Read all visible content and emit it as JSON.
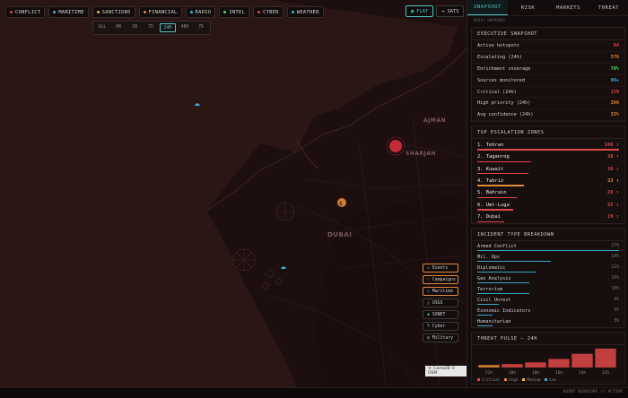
{
  "topbar": {
    "chips": [
      {
        "label": "CONFLICT",
        "color": "#e04040"
      },
      {
        "label": "MARITIME",
        "color": "#3ab0d8"
      },
      {
        "label": "SANCTIONS",
        "color": "#e0c040"
      },
      {
        "label": "FINANCIAL",
        "color": "#e08a3a"
      },
      {
        "label": "RADIO",
        "color": "#3ab0d8"
      },
      {
        "label": "INTEL",
        "color": "#60d060"
      },
      {
        "label": "CYBER",
        "color": "#e04040"
      },
      {
        "label": "WEATHER",
        "color": "#3ab0d8"
      }
    ]
  },
  "timebar": {
    "options": [
      "ALL",
      "6M",
      "1M",
      "7D",
      "24H",
      "48H",
      "7D"
    ],
    "active_index": 4
  },
  "view": {
    "flat": "FLAT",
    "sats": "SATS"
  },
  "map": {
    "labels": {
      "ajman": "AJMAN",
      "sharjah": "SHARJAH",
      "dubai": "DUBAI"
    },
    "attribution": "© CartoDB © OSM"
  },
  "layers": [
    {
      "label": "Events",
      "on": true,
      "icon": "◇",
      "color": "#e08a3a"
    },
    {
      "label": "Campaigns",
      "on": true,
      "icon": "◌",
      "color": "#e08a3a"
    },
    {
      "label": "Maritime",
      "on": true,
      "icon": "⚓",
      "color": "#3ab0d8"
    },
    {
      "label": "USGS",
      "on": false,
      "icon": "△",
      "color": "#e0a040"
    },
    {
      "label": "SONET",
      "on": false,
      "icon": "◆",
      "color": "#60d060"
    },
    {
      "label": "Cyber",
      "on": false,
      "icon": "ϟ",
      "color": "#d0d0d0"
    },
    {
      "label": "Military",
      "on": false,
      "icon": "◎",
      "color": "#d0d0d0"
    }
  ],
  "panel": {
    "tabs": [
      "SNAPSHOT",
      "RISK",
      "MARKETS",
      "THREAT"
    ],
    "subheader_left": "DAILY SNAPSHOT",
    "subheader_right": "· · · · · · ·",
    "exec": {
      "title": "EXECUTIVE SNAPSHOT",
      "rows": [
        {
          "label": "Active hotspots",
          "value": "94",
          "color": "#e04848"
        },
        {
          "label": "Escalating (24h)",
          "value": "576",
          "color": "#e08a3a"
        },
        {
          "label": "Enrichment coverage",
          "value": "70%",
          "color": "#60d060"
        },
        {
          "label": "Sources monitored",
          "value": "90+",
          "color": "#3ab0d8"
        },
        {
          "label": "Critical (24h)",
          "value": "159",
          "color": "#e04848"
        },
        {
          "label": "High priority (24h)",
          "value": "396",
          "color": "#e08a3a"
        },
        {
          "label": "Avg confidence (24h)",
          "value": "33%",
          "color": "#e08a3a"
        }
      ]
    },
    "zones": {
      "title": "TOP ESCALATION ZONES",
      "items": [
        {
          "label": "1. Tehran",
          "score": "100 ↑",
          "level": 1.0,
          "color": "#e04848"
        },
        {
          "label": "2. Taganrog",
          "score": "38 ↑",
          "level": 0.38,
          "color": "#e04848"
        },
        {
          "label": "3. Kuwait",
          "score": "36 ↑",
          "level": 0.36,
          "color": "#e04848"
        },
        {
          "label": "4. Tabriz",
          "score": "33 ↑",
          "level": 0.33,
          "color": "#e08a3a"
        },
        {
          "label": "5. Bahrain",
          "score": "28 ↑",
          "level": 0.28,
          "color": "#e04848"
        },
        {
          "label": "6. Umt-Luga",
          "score": "25 ↑",
          "level": 0.25,
          "color": "#e04848"
        },
        {
          "label": "7. Dubai",
          "score": "19 ↑",
          "level": 0.19,
          "color": "#e04848"
        }
      ]
    },
    "incidents": {
      "title": "INCIDENT TYPE BREAKDOWN",
      "items": [
        {
          "label": "Armed Conflict",
          "count": "27%",
          "level": 1.0
        },
        {
          "label": "Mil. Ops",
          "count": "14%",
          "level": 0.52
        },
        {
          "label": "Diplomatic",
          "count": "11%",
          "level": 0.41
        },
        {
          "label": "Geo Analysis",
          "count": "10%",
          "level": 0.37
        },
        {
          "label": "Terrorism",
          "count": "10%",
          "level": 0.37
        },
        {
          "label": "Civil Unrest",
          "count": "4%",
          "level": 0.15
        },
        {
          "label": "Economic Indicators",
          "count": "3%",
          "level": 0.11
        },
        {
          "label": "Humanitarian",
          "count": "3%",
          "level": 0.11
        }
      ]
    },
    "pulse": {
      "title": "THREAT PULSE — 24H",
      "legend": [
        {
          "label": "Critical",
          "color": "#e04848"
        },
        {
          "label": "High",
          "color": "#e08a3a"
        },
        {
          "label": "Medium",
          "color": "#e0c040"
        },
        {
          "label": "Low",
          "color": "#3ab0d8"
        }
      ]
    }
  },
  "chart_data": {
    "type": "bar",
    "title": "THREAT PULSE — 24H",
    "categories": [
      "22h",
      "20h",
      "18h",
      "16h",
      "14h",
      "12h"
    ],
    "values": [
      3,
      4,
      6,
      10,
      16,
      22
    ],
    "ylim": [
      0,
      24
    ]
  },
  "status": "OSINT GEOSCOPE // ACTIVE"
}
